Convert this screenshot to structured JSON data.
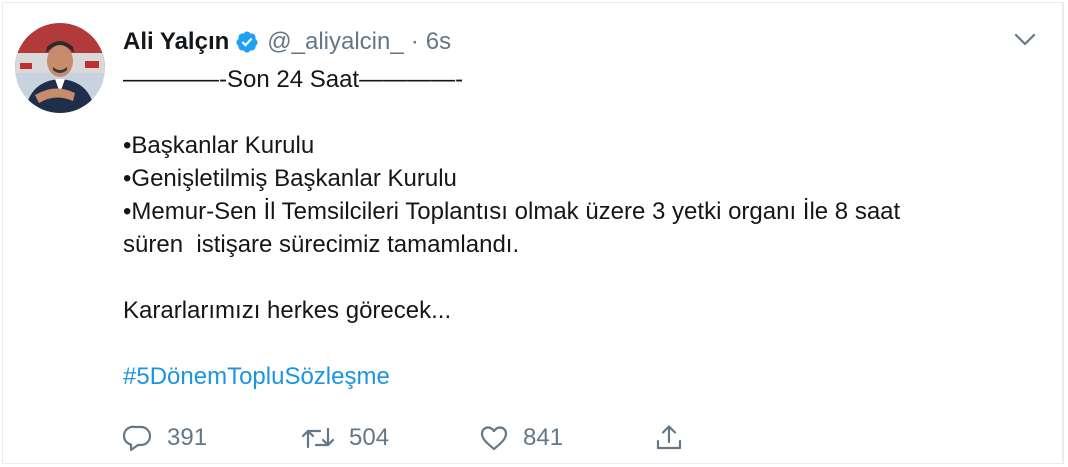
{
  "tweet": {
    "author": {
      "display_name": "Ali Yalçın",
      "handle": "@_aliyalcin_",
      "verified": true
    },
    "separator": "·",
    "timestamp": "6s",
    "body": {
      "heading": "————-Son 24 Saat————-",
      "bullets": [
        "•Başkanlar Kurulu",
        "•Genişletilmiş Başkanlar Kurulu",
        "•Memur-Sen İl Temsilcileri Toplantısı olmak üzere 3 yetki organı İle 8 saat",
        "süren  istişare sürecimiz tamamlandı."
      ],
      "closing": "Kararlarımızı herkes görecek...",
      "hashtag": "#5DönemTopluSözleşme"
    },
    "stats": {
      "replies": "391",
      "retweets": "504",
      "likes": "841"
    }
  },
  "colors": {
    "link": "#1b95e0",
    "muted": "#657786",
    "verified_badge": "#1da1f2"
  },
  "icons": {
    "verified": "verified-badge-icon",
    "caret": "chevron-down-icon",
    "reply": "reply-icon",
    "retweet": "retweet-icon",
    "like": "heart-icon",
    "share": "share-icon"
  }
}
